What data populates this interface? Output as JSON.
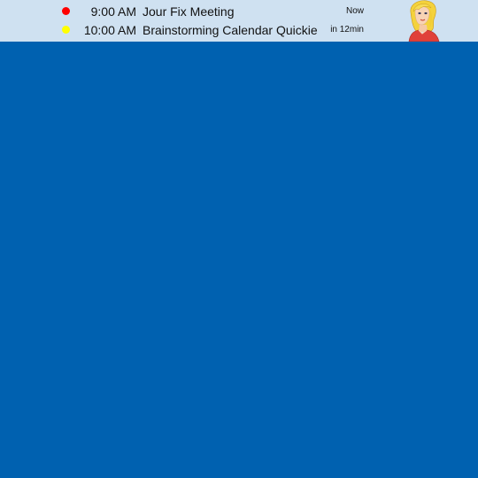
{
  "banner": {
    "events": [
      {
        "time": "9:00 AM",
        "title": "Jour Fix Meeting",
        "when": "Now",
        "status_color": "#ff0000"
      },
      {
        "time": "10:00 AM",
        "title": "Brainstorming Calendar Quickie",
        "when": "in 12min",
        "status_color": "#ffff00"
      }
    ],
    "avatar_icon": "assistant-avatar-icon",
    "background_color": "#cfe1f1"
  },
  "desktop": {
    "background_color": "#0061b0"
  }
}
